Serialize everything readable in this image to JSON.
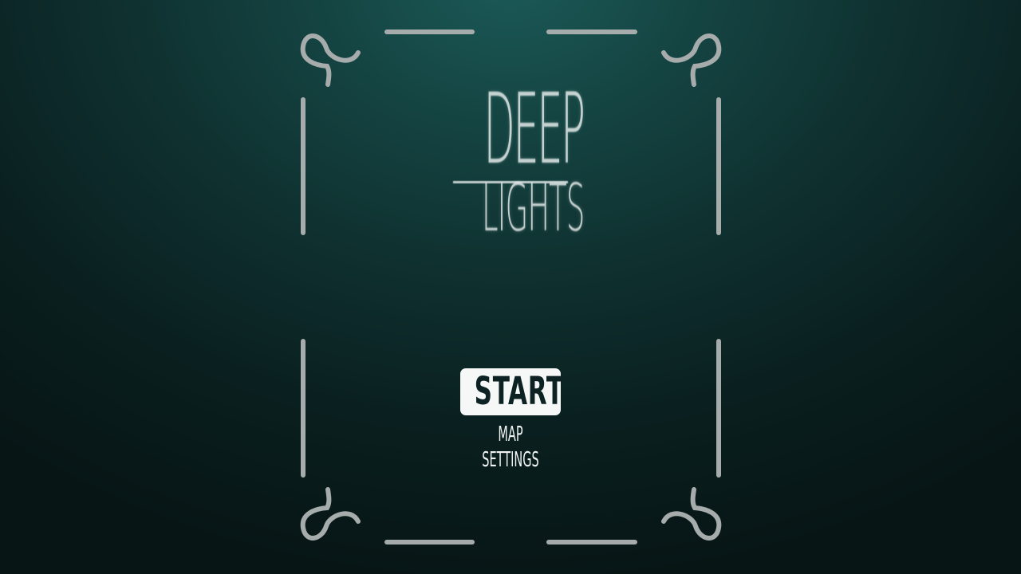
{
  "title": {
    "line1": "DEEP",
    "line2": "LIGHTS"
  },
  "menu": {
    "items": [
      {
        "label": "START",
        "selected": true
      },
      {
        "label": "MAP",
        "selected": false
      },
      {
        "label": "SETTINGS",
        "selected": false
      }
    ]
  },
  "colors": {
    "background_top": "#1b5a58",
    "background_bottom": "#071515",
    "frame": "#a6acab",
    "text": "#f2f4f4",
    "selected_fill": "#f6f8f8",
    "selected_text": "#0c2223"
  },
  "icons": {
    "corner": "swirl-ornament-icon"
  }
}
